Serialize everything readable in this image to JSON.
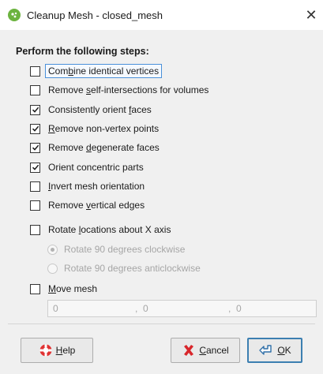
{
  "window": {
    "title": "Cleanup Mesh - closed_mesh",
    "close_glyph": "✕",
    "app_icon": "leapfrog-app-icon"
  },
  "section": {
    "heading": "Perform the following steps:"
  },
  "steps": [
    {
      "pre": "Com",
      "u": "b",
      "post": "ine identical vertices",
      "checked": false,
      "focused": true
    },
    {
      "pre": "Remove ",
      "u": "s",
      "post": "elf-intersections for volumes",
      "checked": false
    },
    {
      "pre": "Consistently orient ",
      "u": "f",
      "post": "aces",
      "checked": true
    },
    {
      "pre": "",
      "u": "R",
      "post": "emove non-vertex points",
      "checked": true
    },
    {
      "pre": "Remove ",
      "u": "d",
      "post": "egenerate faces",
      "checked": true
    },
    {
      "pre": "Orient concentric parts",
      "u": "",
      "post": "",
      "checked": true
    },
    {
      "pre": "",
      "u": "I",
      "post": "nvert mesh orientation",
      "checked": false
    },
    {
      "pre": "Remove ",
      "u": "v",
      "post": "ertical edges",
      "checked": false
    },
    {
      "pre": "Rotate ",
      "u": "l",
      "post": "ocations about X axis",
      "checked": false
    }
  ],
  "rotate_options": [
    {
      "label": "Rotate 90 degrees clockwise",
      "selected": true,
      "enabled": false
    },
    {
      "label": "Rotate 90 degrees anticlockwise",
      "selected": false,
      "enabled": false
    }
  ],
  "move_mesh": {
    "u": "M",
    "post": "ove mesh",
    "checked": false,
    "x": "0",
    "y": "0",
    "z": "0",
    "sep1": ",",
    "sep2": ","
  },
  "buttons": {
    "help": {
      "u": "H",
      "post": "elp",
      "icon": "lifebuoy-icon"
    },
    "cancel": {
      "u": "C",
      "post": "ancel",
      "icon": "cancel-x-icon"
    },
    "ok": {
      "pre": "",
      "u": "O",
      "post": "K",
      "icon": "ok-arrow-icon"
    }
  },
  "colors": {
    "accent": "#3c7fb1",
    "focus": "#4a90d9",
    "app_icon_green": "#6cb33f",
    "cancel_red": "#d8262b",
    "help_red": "#e03131"
  }
}
